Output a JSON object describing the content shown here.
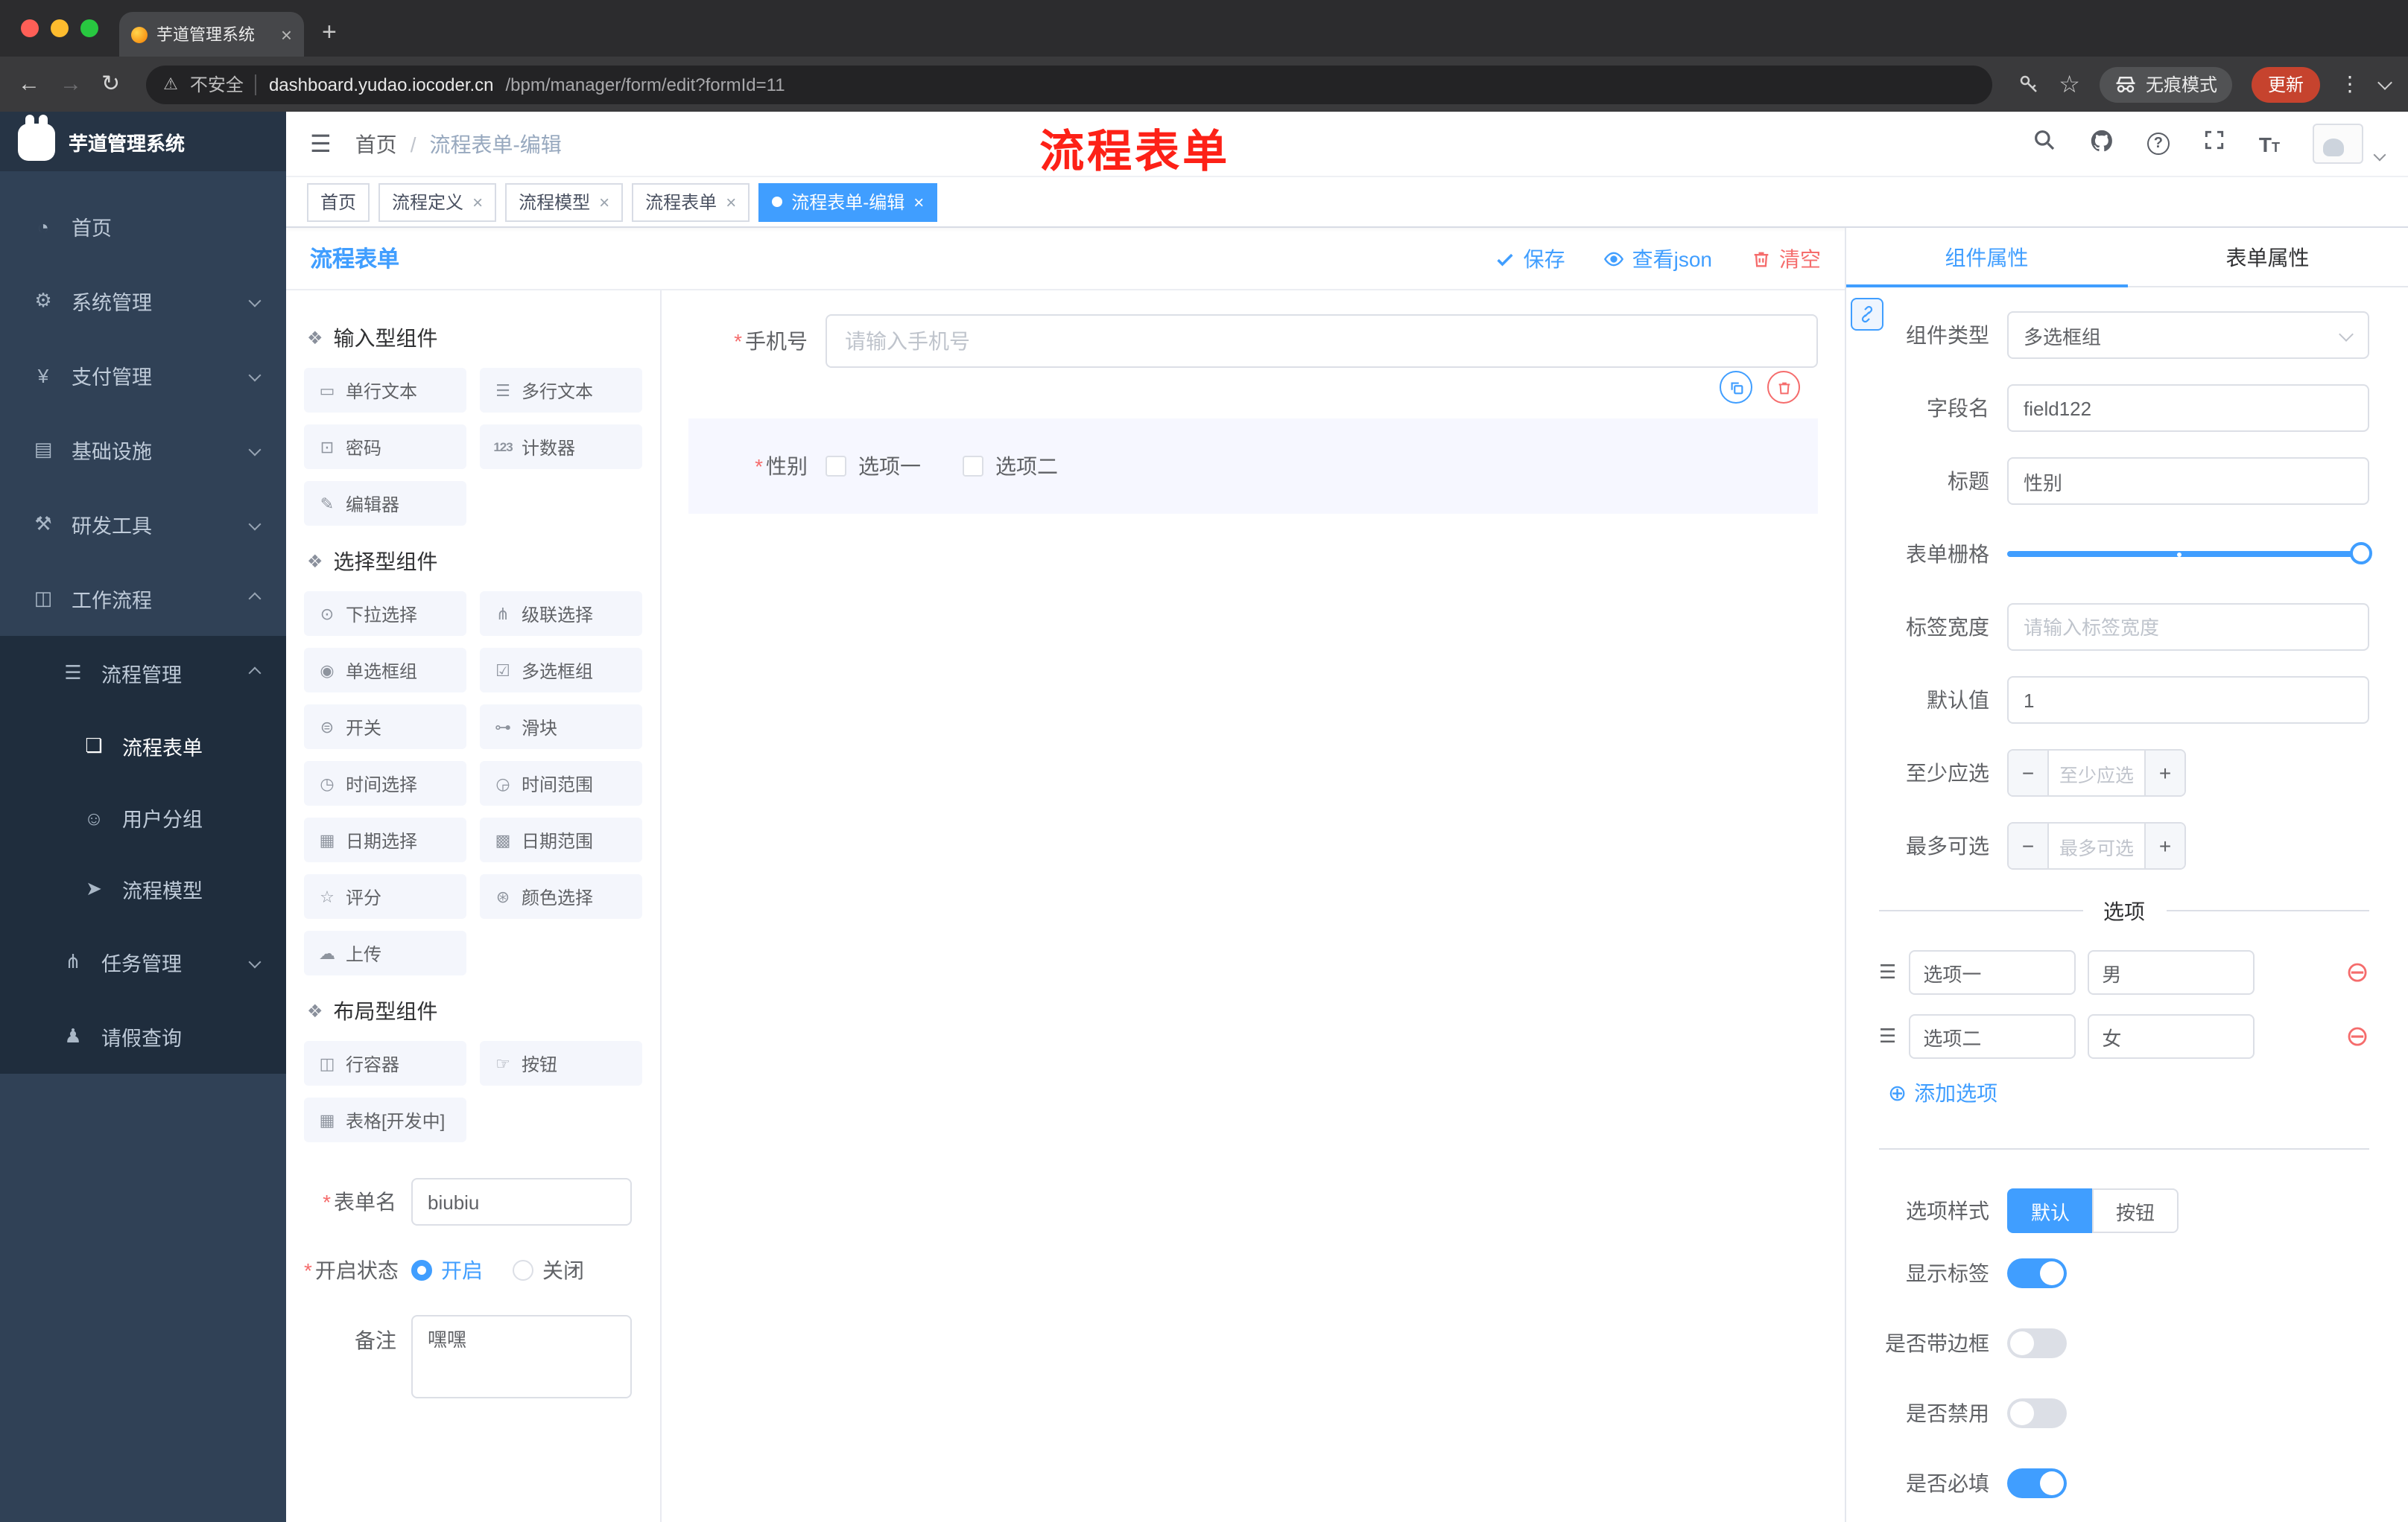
{
  "browser": {
    "tab_title": "芋道管理系统",
    "new_tab": "+",
    "security_label": "不安全",
    "url_host": "dashboard.yudao.iocoder.cn",
    "url_path": "/bpm/manager/form/edit?formId=11",
    "incognito_label": "无痕模式",
    "update_button": "更新",
    "menu_dots": "⋮"
  },
  "sidebar": {
    "logo_title": "芋道管理系统",
    "items": [
      {
        "label": "首页",
        "icon": "dashboard-icon"
      },
      {
        "label": "系统管理",
        "icon": "gear-icon"
      },
      {
        "label": "支付管理",
        "icon": "yen-icon"
      },
      {
        "label": "基础设施",
        "icon": "infrastructure-icon"
      },
      {
        "label": "研发工具",
        "icon": "tools-icon"
      },
      {
        "label": "工作流程",
        "icon": "workflow-icon"
      },
      {
        "label": "流程管理",
        "icon": "list-icon"
      },
      {
        "label": "流程表单",
        "icon": "form-icon"
      },
      {
        "label": "用户分组",
        "icon": "user-group-icon"
      },
      {
        "label": "流程模型",
        "icon": "model-icon"
      },
      {
        "label": "任务管理",
        "icon": "task-icon"
      },
      {
        "label": "请假查询",
        "icon": "person-icon"
      }
    ]
  },
  "header": {
    "breadcrumb_home": "首页",
    "breadcrumb_sep": "/",
    "breadcrumb_current": "流程表单-编辑",
    "annotation": "流程表单"
  },
  "tags": [
    {
      "label": "首页"
    },
    {
      "label": "流程定义"
    },
    {
      "label": "流程模型"
    },
    {
      "label": "流程表单"
    },
    {
      "label": "流程表单-编辑"
    }
  ],
  "designer": {
    "title": "流程表单",
    "save": "保存",
    "view_json": "查看json",
    "clear": "清空"
  },
  "palette": {
    "sections": [
      {
        "title": "输入型组件",
        "items": [
          "单行文本",
          "多行文本",
          "密码",
          "计数器",
          "编辑器"
        ]
      },
      {
        "title": "选择型组件",
        "items": [
          "下拉选择",
          "级联选择",
          "单选框组",
          "多选框组",
          "开关",
          "滑块",
          "时间选择",
          "时间范围",
          "日期选择",
          "日期范围",
          "评分",
          "颜色选择",
          "上传"
        ]
      },
      {
        "title": "布局型组件",
        "items": [
          "行容器",
          "按钮",
          "表格[开发中]"
        ]
      }
    ],
    "counter_icon_text": "123"
  },
  "form_meta": {
    "name_label": "表单名",
    "name_value": "biubiu",
    "status_label": "开启状态",
    "status_on": "开启",
    "status_off": "关闭",
    "remark_label": "备注",
    "remark_value": "嘿嘿"
  },
  "canvas": {
    "phone_label": "手机号",
    "phone_placeholder": "请输入手机号",
    "gender_label": "性别",
    "gender_option1": "选项一",
    "gender_option2": "选项二"
  },
  "panel": {
    "tab_component": "组件属性",
    "tab_form": "表单属性",
    "type_label": "组件类型",
    "type_value": "多选框组",
    "field_label": "字段名",
    "field_value": "field122",
    "title_label": "标题",
    "title_value": "性别",
    "grid_label": "表单栅格",
    "label_width_label": "标签宽度",
    "label_width_placeholder": "请输入标签宽度",
    "default_label": "默认值",
    "default_value": "1",
    "min_label": "至少应选",
    "min_placeholder": "至少应选",
    "max_label": "最多可选",
    "max_placeholder": "最多可选",
    "options_title": "选项",
    "options": [
      {
        "name": "选项一",
        "value": "男"
      },
      {
        "name": "选项二",
        "value": "女"
      }
    ],
    "add_option": "添加选项",
    "style_label": "选项样式",
    "style_default": "默认",
    "style_button": "按钮",
    "toggle_show_label": "显示标签",
    "toggle_border": "是否带边框",
    "toggle_disabled": "是否禁用",
    "toggle_required": "是否必填"
  },
  "colors": {
    "accent": "#409EFF",
    "danger": "#F56C6C",
    "sidebar": "#304156",
    "sidebar_sub": "#1F2D3D",
    "annotation_red": "#FD2117",
    "selected_item_bg": "#F6F7FF"
  }
}
